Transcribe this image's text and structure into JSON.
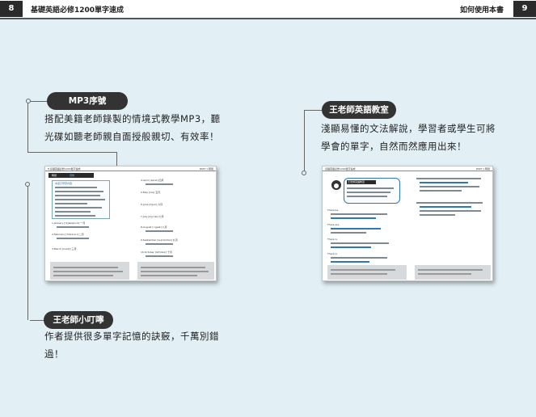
{
  "header": {
    "left_page_number": "8",
    "left_title": "基礎英語必修1200單字速成",
    "right_title": "如何使用本書",
    "right_page_number": "9"
  },
  "callouts": {
    "mp3": {
      "label": "MP3序號",
      "lines": [
        "搭配美籍老師錄製的情境式教學MP3，聽",
        "光碟如聽老師親自面授般親切、有效率！"
      ]
    },
    "teacher_class": {
      "label": "王老師英語教室",
      "lines": [
        "淺顯易懂的文法解說，學習者或學生可將",
        "學會的單字，自然而然應用出來！"
      ]
    },
    "tips": {
      "label": "王老師小叮嚀",
      "lines": [
        "作者提供很多單字記憶的訣竅，千萬別錯",
        "過！"
      ]
    }
  },
  "left_thumb": {
    "header_left": "8  基礎英語必修1200單字速成",
    "header_right": "PART 1  時間",
    "section_label": "時間",
    "section_sub": "月份",
    "intro": "本單元學習內容",
    "months_left": [
      "1.January [ˈdʒænjʊˌɛrɪ] 一月",
      "2.February [ˈfɛbrʊˌɛrɪ] 二月",
      "3.March [mɑrtʃ] 三月"
    ],
    "months_right": [
      "4.April [ˈeprəl] 四月",
      "5.May [me] 五月",
      "6.June [dʒun] 六月",
      "7.July [dʒuˈlaɪ] 七月",
      "8.August [ˈɔgəst] 八月",
      "9.September [sɛpˈtɛmbɚ] 九月",
      "10.October [ɑkˈtobɚ] 十月"
    ]
  },
  "right_thumb": {
    "header_left": "基礎英語必修1200單字速成",
    "header_right": "PART 1  時間",
    "bubble": "王老師英語教室",
    "items": [
      "There be",
      "There are",
      "There is",
      "There is"
    ]
  }
}
